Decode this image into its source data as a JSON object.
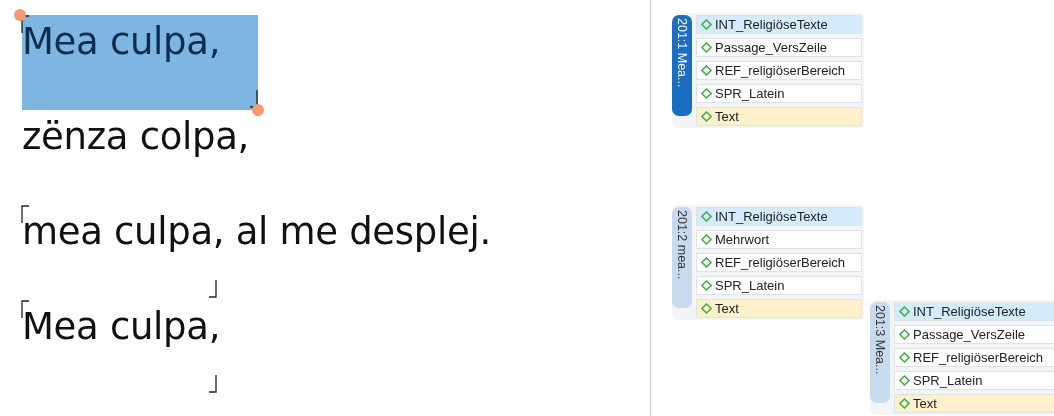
{
  "document": {
    "paragraphs": [
      {
        "text": "Mea culpa,",
        "segment": true,
        "selected": true
      },
      {
        "text": "zënza colpa,",
        "segment": false,
        "selected": false
      },
      {
        "text": "mea culpa, al me desplej.",
        "segment": true,
        "selected": false
      },
      {
        "text": "Mea culpa,",
        "segment": true,
        "selected": false
      }
    ]
  },
  "margin": {
    "groups": [
      {
        "label": "201:1 Mea...",
        "selected": true,
        "codes": [
          {
            "name": "INT_ReligiöseTexte",
            "color": "#d3ebfa"
          },
          {
            "name": "Passage_VersZeile",
            "color": "#ffffff"
          },
          {
            "name": "REF_religiöserBereich",
            "color": "#ffffff"
          },
          {
            "name": "SPR_Latein",
            "color": "#ffffff"
          },
          {
            "name": "Text",
            "color": "#fdf1cc"
          }
        ]
      },
      {
        "label": "201:2 mea...",
        "selected": false,
        "codes": [
          {
            "name": "INT_ReligiöseTexte",
            "color": "#d3ebfa"
          },
          {
            "name": "Mehrwort",
            "color": "#ffffff"
          },
          {
            "name": "REF_religiöserBereich",
            "color": "#ffffff"
          },
          {
            "name": "SPR_Latein",
            "color": "#ffffff"
          },
          {
            "name": "Text",
            "color": "#fdf1cc"
          }
        ]
      },
      {
        "label": "201:3 Mea...",
        "selected": false,
        "codes": [
          {
            "name": "INT_ReligiöseTexte",
            "color": "#d3ebfa"
          },
          {
            "name": "Passage_VersZeile",
            "color": "#ffffff"
          },
          {
            "name": "REF_religiöserBereich",
            "color": "#ffffff"
          },
          {
            "name": "SPR_Latein",
            "color": "#ffffff"
          },
          {
            "name": "Text",
            "color": "#fdf1cc"
          }
        ]
      }
    ]
  }
}
